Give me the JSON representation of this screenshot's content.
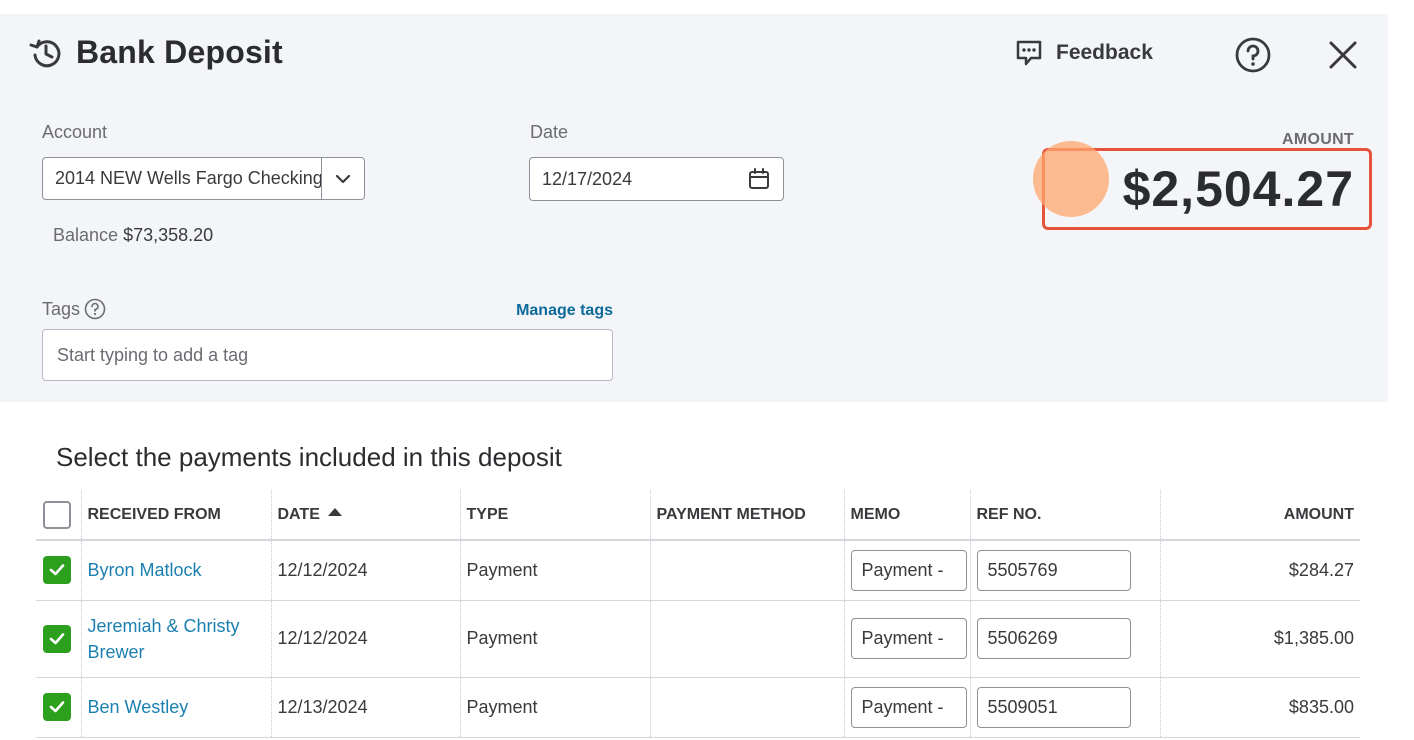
{
  "header": {
    "title": "Bank Deposit",
    "feedback_label": "Feedback"
  },
  "form": {
    "account_label": "Account",
    "account_value": "2014 NEW Wells Fargo Checking",
    "date_label": "Date",
    "date_value": "12/17/2024",
    "balance_label": "Balance",
    "balance_value": "$73,358.20",
    "amount_label": "AMOUNT",
    "amount_value": "$2,504.27",
    "tags_label": "Tags",
    "manage_tags_label": "Manage tags",
    "tags_placeholder": "Start typing to add a tag"
  },
  "payments": {
    "title": "Select the payments included in this deposit",
    "columns": {
      "received_from": "RECEIVED FROM",
      "date": "DATE",
      "type": "TYPE",
      "payment_method": "PAYMENT METHOD",
      "memo": "MEMO",
      "ref_no": "REF NO.",
      "amount": "AMOUNT"
    },
    "rows": [
      {
        "received_from": "Byron Matlock",
        "date": "12/12/2024",
        "type": "Payment",
        "payment_method": "",
        "memo": "Payment - ",
        "ref_no": "5505769",
        "amount": "$284.27",
        "checked": true
      },
      {
        "received_from": "Jeremiah & Christy Brewer",
        "date": "12/12/2024",
        "type": "Payment",
        "payment_method": "",
        "memo": "Payment - ",
        "ref_no": "5506269",
        "amount": "$1,385.00",
        "checked": true
      },
      {
        "received_from": "Ben Westley",
        "date": "12/13/2024",
        "type": "Payment",
        "payment_method": "",
        "memo": "Payment - ",
        "ref_no": "5509051",
        "amount": "$835.00",
        "checked": true
      }
    ]
  },
  "colors": {
    "highlight_border": "#e5533b",
    "checkbox_green": "#2ca01c",
    "link_blue": "#1b7fb0",
    "manage_tags_blue": "#0d6a9a"
  },
  "icons": {
    "header": "history-icon",
    "feedback": "speech-bubble-icon",
    "help": "question-circle-icon",
    "close": "close-icon",
    "account_dropdown": "chevron-down-icon",
    "date": "calendar-icon",
    "tags_help": "question-circle-icon",
    "checkbox": "checkmark-icon"
  }
}
